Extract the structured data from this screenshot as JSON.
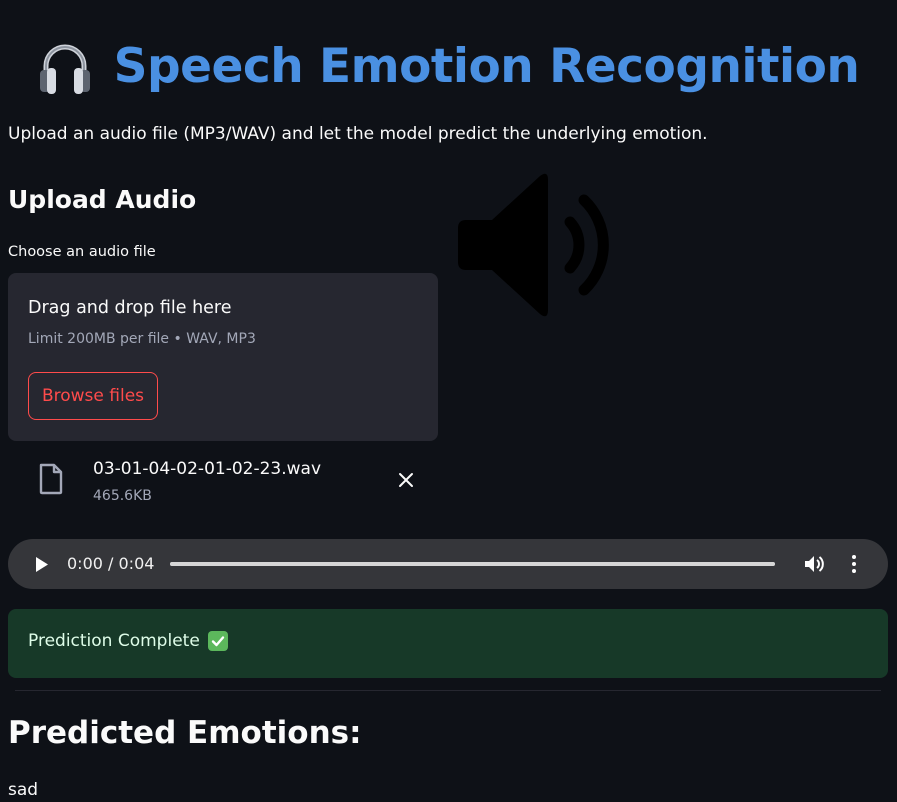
{
  "header": {
    "title": "Speech Emotion Recognition",
    "title_icon": "headphones-icon",
    "title_color": "#4a90e2"
  },
  "intro_text": "Upload an audio file (MP3/WAV) and let the model predict the underlying emotion.",
  "upload_section": {
    "heading": "Upload Audio",
    "decorative_icon": "speaker-icon",
    "file_uploader": {
      "label": "Choose an audio file",
      "dropzone_title": "Drag and drop file here",
      "limit_text": "Limit 200MB per file • WAV, MP3",
      "browse_label": "Browse files",
      "accent_color": "#ff4b4b"
    },
    "uploaded_file": {
      "name": "03-01-04-02-01-02-23.wav",
      "size": "465.6KB",
      "icon": "file-icon",
      "remove_icon": "close-icon"
    }
  },
  "audio_player": {
    "time_display": "0:00 / 0:04",
    "progress": 0,
    "icons": [
      "play-icon",
      "volume-icon",
      "more-vertical-icon"
    ]
  },
  "status": {
    "message": "Prediction Complete",
    "icon": "check-mark-icon",
    "background_color": "#173928"
  },
  "results": {
    "heading": "Predicted Emotions:",
    "emotion": "sad"
  }
}
